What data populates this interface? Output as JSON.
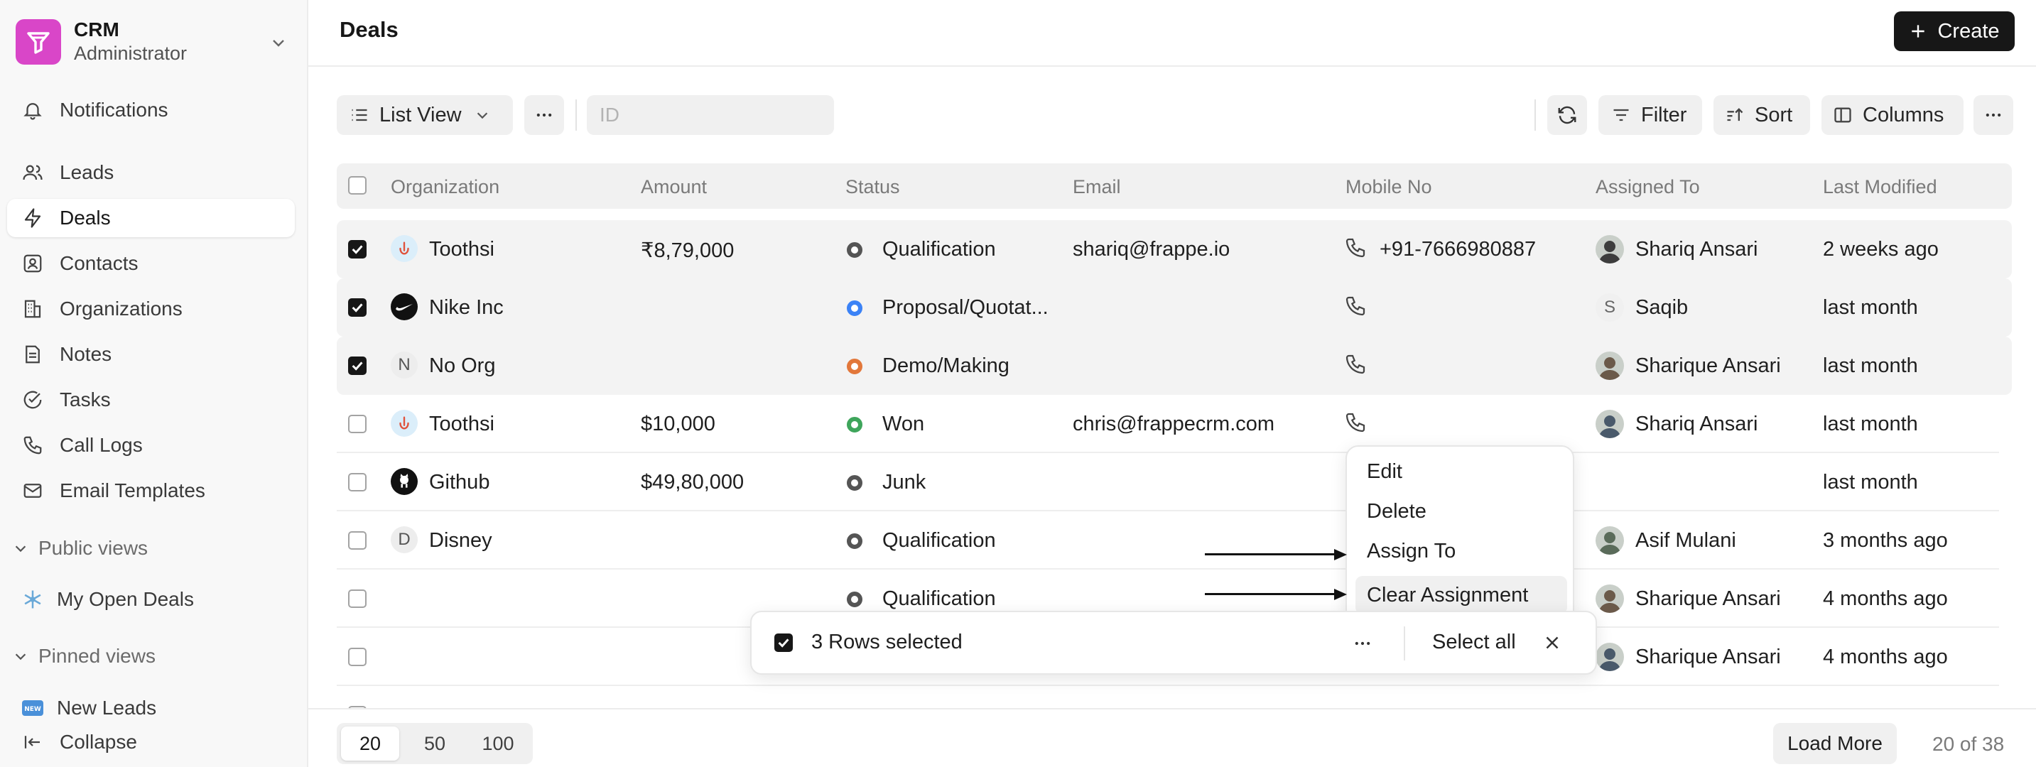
{
  "sidebar": {
    "app_name": "CRM",
    "role": "Administrator",
    "items": [
      {
        "label": "Notifications",
        "icon": "bell-icon"
      },
      {
        "label": "Leads",
        "icon": "users-icon"
      },
      {
        "label": "Deals",
        "icon": "zap-icon"
      },
      {
        "label": "Contacts",
        "icon": "contact-icon"
      },
      {
        "label": "Organizations",
        "icon": "building-icon"
      },
      {
        "label": "Notes",
        "icon": "note-icon"
      },
      {
        "label": "Tasks",
        "icon": "check-circle-icon"
      },
      {
        "label": "Call Logs",
        "icon": "phone-icon"
      },
      {
        "label": "Email Templates",
        "icon": "mail-icon"
      }
    ],
    "public_views_label": "Public views",
    "public_views": [
      {
        "label": "My Open Deals",
        "icon": "snowflake-icon"
      }
    ],
    "pinned_views_label": "Pinned views",
    "pinned_views": [
      {
        "label": "New Leads",
        "icon": "new-badge-icon"
      }
    ],
    "collapse_label": "Collapse"
  },
  "header": {
    "title": "Deals",
    "create_label": "Create"
  },
  "toolbar": {
    "view_label": "List View",
    "id_placeholder": "ID",
    "filter_label": "Filter",
    "sort_label": "Sort",
    "columns_label": "Columns"
  },
  "table": {
    "columns": [
      "Organization",
      "Amount",
      "Status",
      "Email",
      "Mobile No",
      "Assigned To",
      "Last Modified"
    ],
    "rows": [
      {
        "selected": true,
        "org": "Toothsi",
        "org_icon": "toothsi",
        "amount": "₹8,79,000",
        "status": "Qualification",
        "status_color": "#555555",
        "email": "shariq@frappe.io",
        "mobile": "+91-7666980887",
        "assigned": "Shariq Ansari",
        "avatar": "photo",
        "modified": "2 weeks ago"
      },
      {
        "selected": true,
        "org": "Nike Inc",
        "org_icon": "nike",
        "amount": "",
        "status": "Proposal/Quotat...",
        "status_color": "#3b82f6",
        "email": "",
        "mobile": "",
        "assigned": "Saqib",
        "avatar": "S",
        "modified": "last month"
      },
      {
        "selected": true,
        "org": "No Org",
        "org_icon": "N",
        "amount": "",
        "status": "Demo/Making",
        "status_color": "#e2773a",
        "email": "",
        "mobile": "",
        "assigned": "Sharique Ansari",
        "avatar": "photo",
        "modified": "last month"
      },
      {
        "selected": false,
        "org": "Toothsi",
        "org_icon": "toothsi",
        "amount": "$10,000",
        "status": "Won",
        "status_color": "#3ea55b",
        "email": "chris@frappecrm.com",
        "mobile": "",
        "assigned": "Shariq Ansari",
        "avatar": "photo",
        "modified": "last month"
      },
      {
        "selected": false,
        "org": "Github",
        "org_icon": "github",
        "amount": "$49,80,000",
        "status": "Junk",
        "status_color": "#555555",
        "email": "",
        "mobile": "",
        "assigned": "",
        "avatar": "",
        "modified": "last month"
      },
      {
        "selected": false,
        "org": "Disney",
        "org_icon": "D",
        "amount": "",
        "status": "Qualification",
        "status_color": "#555555",
        "email": "",
        "mobile": "",
        "assigned": "Asif Mulani",
        "avatar": "photo",
        "modified": "3 months ago"
      },
      {
        "selected": false,
        "org": "",
        "org_icon": "",
        "amount": "",
        "status": "Qualification",
        "status_color": "#555555",
        "email": "",
        "mobile": "",
        "assigned": "Sharique Ansari",
        "avatar": "photo",
        "modified": "4 months ago"
      },
      {
        "selected": false,
        "org": "",
        "org_icon": "",
        "amount": "",
        "status": "",
        "status_color": "#555555",
        "email": "",
        "mobile": "",
        "assigned": "Sharique Ansari",
        "avatar": "photo",
        "modified": "4 months ago"
      }
    ]
  },
  "context_menu": {
    "items": [
      "Edit",
      "Delete",
      "Assign To",
      "Clear Assignment"
    ]
  },
  "selection_bar": {
    "count_text": "3 Rows selected",
    "select_all_label": "Select all"
  },
  "footer": {
    "page_sizes": [
      "20",
      "50",
      "100"
    ],
    "load_more_label": "Load More",
    "count_text": "20 of 38"
  },
  "colors": {
    "brand": "#d946c8",
    "primary_button": "#171717"
  }
}
